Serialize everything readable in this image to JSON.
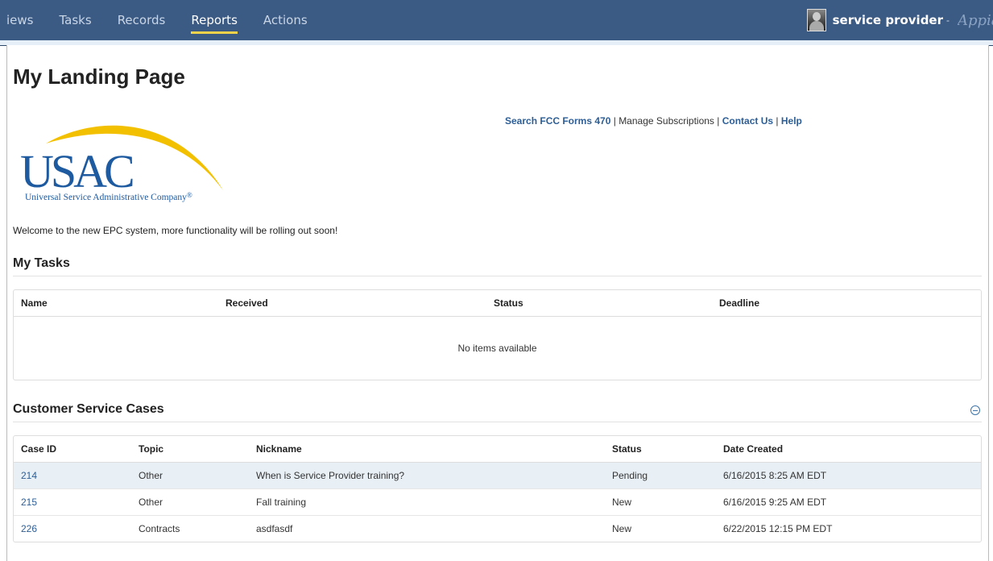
{
  "nav": {
    "items": [
      {
        "label": "iews",
        "active": false
      },
      {
        "label": "Tasks",
        "active": false
      },
      {
        "label": "Records",
        "active": false
      },
      {
        "label": "Reports",
        "active": true
      },
      {
        "label": "Actions",
        "active": false
      }
    ]
  },
  "user": {
    "name": "service provider",
    "caret": "-",
    "brand": "Appia"
  },
  "page_title": "My Landing Page",
  "links": {
    "search": "Search FCC Forms 470",
    "sep1": " | ",
    "manage": "Manage Subscriptions",
    "sep2": " | ",
    "contact": "Contact Us",
    "sep3": " | ",
    "help": "Help"
  },
  "logo": {
    "wordmark": "USAC",
    "subtitle": "Universal Service Administrative Company",
    "reg": "®",
    "arc_color": "#f3c000",
    "text_color": "#1e5aa0"
  },
  "welcome": "Welcome to the new EPC system, more functionality will be rolling out soon!",
  "my_tasks": {
    "title": "My Tasks",
    "columns": [
      "Name",
      "Received",
      "Status",
      "Deadline"
    ],
    "empty_text": "No items available"
  },
  "cases": {
    "title": "Customer Service Cases",
    "collapse_icon": "collapse-minus-icon",
    "columns": [
      "Case ID",
      "Topic",
      "Nickname",
      "Status",
      "Date Created"
    ],
    "rows": [
      {
        "id": "214",
        "topic": "Other",
        "nickname": "When is Service Provider training?",
        "status": "Pending",
        "date": "6/16/2015 8:25 AM EDT"
      },
      {
        "id": "215",
        "topic": "Other",
        "nickname": "Fall training",
        "status": "New",
        "date": "6/16/2015 9:25 AM EDT"
      },
      {
        "id": "226",
        "topic": "Contracts",
        "nickname": "asdfasdf",
        "status": "New",
        "date": "6/22/2015 12:15 PM EDT"
      }
    ]
  },
  "colors": {
    "topbar": "#3b5a84",
    "link": "#2d5e96",
    "active_underline": "#f3d34a",
    "row_highlight": "#e8f0f6"
  }
}
